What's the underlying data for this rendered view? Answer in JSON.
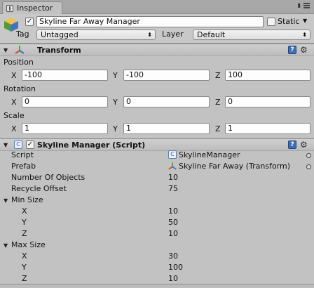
{
  "tab": {
    "label": "Inspector",
    "icon": "inspector-icon"
  },
  "gameobject": {
    "active": true,
    "name": "Skyline Far Away Manager",
    "static_label": "Static",
    "static_checked": false,
    "tag_label": "Tag",
    "tag_value": "Untagged",
    "layer_label": "Layer",
    "layer_value": "Default"
  },
  "transform": {
    "title": "Transform",
    "position_label": "Position",
    "rotation_label": "Rotation",
    "scale_label": "Scale",
    "axis_x": "X",
    "axis_y": "Y",
    "axis_z": "Z",
    "position": {
      "x": "-100",
      "y": "-100",
      "z": "100"
    },
    "rotation": {
      "x": "0",
      "y": "0",
      "z": "0"
    },
    "scale": {
      "x": "1",
      "y": "1",
      "z": "1"
    }
  },
  "script_component": {
    "title": "Skyline Manager (Script)",
    "enabled": true,
    "script_label": "Script",
    "script_value": "SkylineManager",
    "prefab_label": "Prefab",
    "prefab_value": "Skyline Far Away (Transform)",
    "number_label": "Number Of Objects",
    "number_value": "10",
    "recycle_label": "Recycle Offset",
    "recycle_value": "75",
    "min_size_label": "Min Size",
    "min_size": {
      "x": "10",
      "y": "50",
      "z": "10"
    },
    "max_size_label": "Max Size",
    "max_size": {
      "x": "30",
      "y": "100",
      "z": "10"
    }
  },
  "colors": {
    "panel": "#c2c2c2",
    "header": "#bdbdbd",
    "field": "#fdfdfd",
    "help": "#3c6fb8"
  }
}
